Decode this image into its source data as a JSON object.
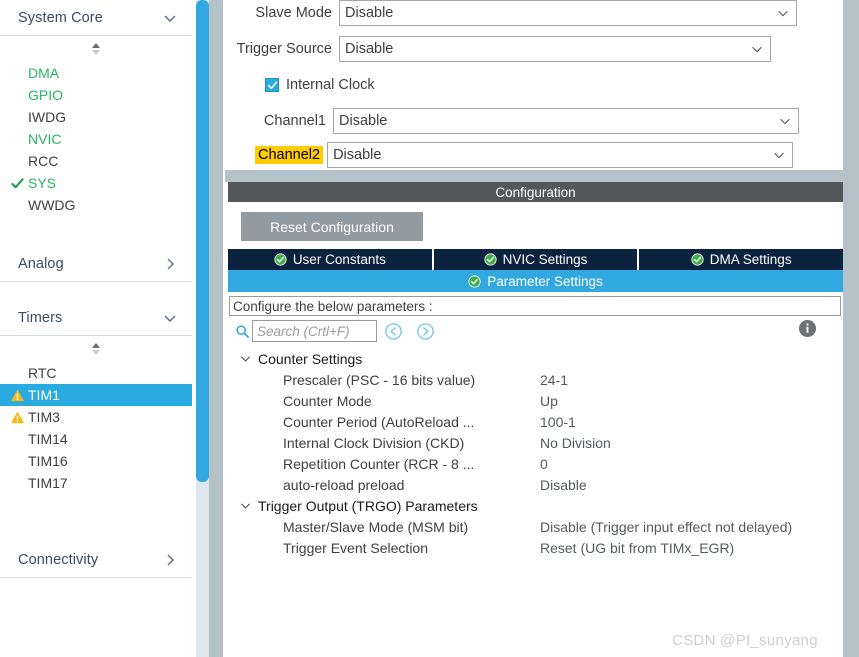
{
  "sidebar": {
    "categories": [
      {
        "label": "System Core",
        "expanded": true,
        "chevron": "chevron-down-icon",
        "items": [
          {
            "label": "DMA",
            "state": "configured",
            "icon": "none"
          },
          {
            "label": "GPIO",
            "state": "configured",
            "icon": "none"
          },
          {
            "label": "IWDG",
            "state": "default",
            "icon": "none"
          },
          {
            "label": "NVIC",
            "state": "configured",
            "icon": "none"
          },
          {
            "label": "RCC",
            "state": "default",
            "icon": "none"
          },
          {
            "label": "SYS",
            "state": "configured",
            "icon": "check-icon"
          },
          {
            "label": "WWDG",
            "state": "default",
            "icon": "none"
          }
        ]
      },
      {
        "label": "Analog",
        "expanded": false,
        "chevron": "chevron-right-icon",
        "items": []
      },
      {
        "label": "Timers",
        "expanded": true,
        "chevron": "chevron-down-icon",
        "items": [
          {
            "label": "RTC",
            "state": "default",
            "icon": "none"
          },
          {
            "label": "TIM1",
            "state": "selected",
            "icon": "warning-icon"
          },
          {
            "label": "TIM3",
            "state": "default",
            "icon": "warning-icon"
          },
          {
            "label": "TIM14",
            "state": "default",
            "icon": "none"
          },
          {
            "label": "TIM16",
            "state": "default",
            "icon": "none"
          },
          {
            "label": "TIM17",
            "state": "default",
            "icon": "none"
          }
        ]
      },
      {
        "label": "Connectivity",
        "expanded": false,
        "chevron": "chevron-right-icon",
        "items": []
      }
    ]
  },
  "top_form": {
    "rows": [
      {
        "label": "Slave Mode",
        "value": "Disable",
        "type": "combo",
        "highlight": false
      },
      {
        "label": "Trigger Source",
        "value": "Disable",
        "type": "combo",
        "highlight": false
      },
      {
        "label": "Internal Clock",
        "value": "",
        "type": "checkbox",
        "checked": true,
        "highlight": false
      },
      {
        "label": "Channel1",
        "value": "Disable",
        "type": "combo",
        "highlight": false
      },
      {
        "label": "Channel2",
        "value": "Disable",
        "type": "combo",
        "highlight": true
      }
    ]
  },
  "configuration": {
    "header_title": "Configuration",
    "reset_button": "Reset Configuration",
    "tabs": [
      {
        "label": "User Constants",
        "icon": "check-circle-icon",
        "active": false
      },
      {
        "label": "NVIC Settings",
        "icon": "check-circle-icon",
        "active": false
      },
      {
        "label": "DMA Settings",
        "icon": "check-circle-icon",
        "active": false
      },
      {
        "label": "Parameter Settings",
        "icon": "check-circle-icon",
        "active": true
      }
    ],
    "description": "Configure the below parameters :",
    "search": {
      "placeholder": "Search (Crtl+F)",
      "value": ""
    },
    "nav_prev_icon": "circle-left-arrow-icon",
    "nav_next_icon": "circle-right-arrow-icon",
    "info_icon": "info-icon",
    "groups": [
      {
        "label": "Counter Settings",
        "expanded": true,
        "params": [
          {
            "name": "Prescaler (PSC - 16 bits value)",
            "value": "24-1"
          },
          {
            "name": "Counter Mode",
            "value": "Up"
          },
          {
            "name": "Counter Period (AutoReload ...",
            "value": "100-1"
          },
          {
            "name": "Internal Clock Division (CKD)",
            "value": "No Division"
          },
          {
            "name": "Repetition Counter (RCR - 8 ...",
            "value": "0"
          },
          {
            "name": "auto-reload preload",
            "value": "Disable"
          }
        ]
      },
      {
        "label": "Trigger Output (TRGO) Parameters",
        "expanded": true,
        "params": [
          {
            "name": "Master/Slave Mode (MSM bit)",
            "value": "Disable (Trigger input effect not delayed)"
          },
          {
            "name": "Trigger Event Selection",
            "value": "Reset (UG bit from TIMx_EGR)"
          }
        ]
      }
    ]
  },
  "watermark": "CSDN @PI_sunyang",
  "colors": {
    "selection_blue": "#29abe2",
    "tab_navy": "#0c2340",
    "tab_active_blue": "#31a8e0",
    "highlight_yellow": "#ffcc00",
    "configured_green": "#27b565",
    "warning_yellow": "#f5b914",
    "header_gray": "#54585a",
    "button_gray": "#919ba1",
    "gutter_gray": "#b6c2c9"
  }
}
